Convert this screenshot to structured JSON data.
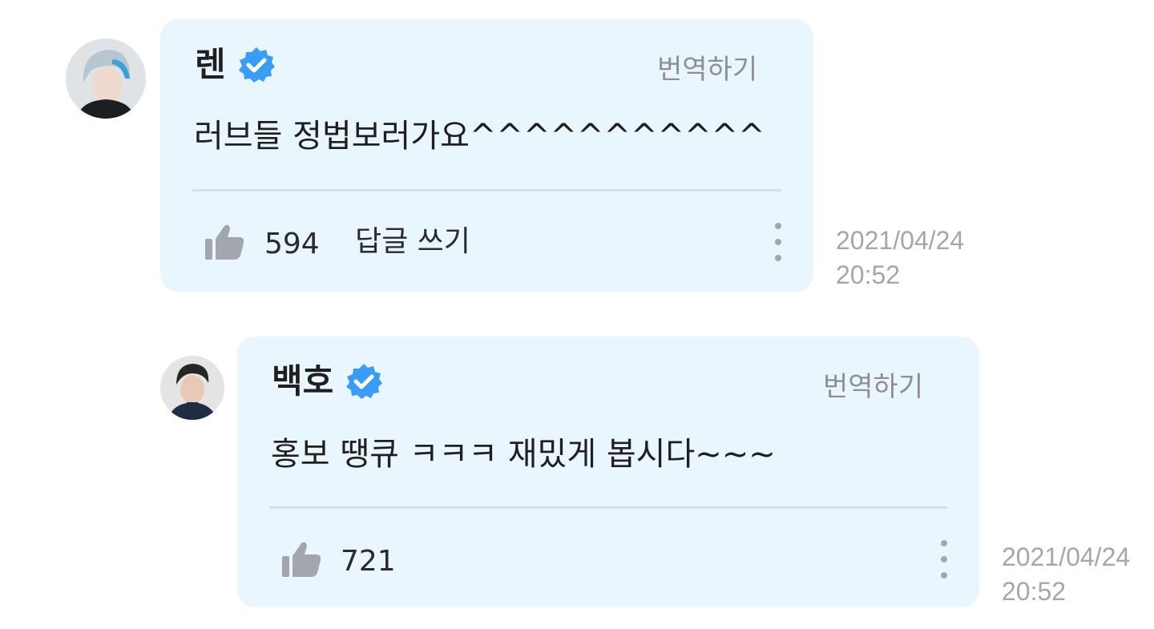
{
  "comments": [
    {
      "author": "렌",
      "translate_label": "번역하기",
      "message": "러브들 정법보러가요^^^^^^^^^^^",
      "likes": "594",
      "reply_label": "답글 쓰기",
      "date": "2021/04/24",
      "time": "20:52"
    },
    {
      "author": "백호",
      "translate_label": "번역하기",
      "message": "홍보 땡큐 ㅋㅋㅋ 재밌게 봅시다~~~",
      "likes": "721",
      "date": "2021/04/24",
      "time": "20:52"
    }
  ],
  "colors": {
    "bubble_bg": "#e9f6fe",
    "verified_badge": "#3b9cf3",
    "muted_text": "#8f8f8f",
    "icon_gray": "#a3a7ad"
  },
  "icons": [
    "verified-badge-icon",
    "thumbs-up-icon",
    "more-vertical-icon"
  ]
}
